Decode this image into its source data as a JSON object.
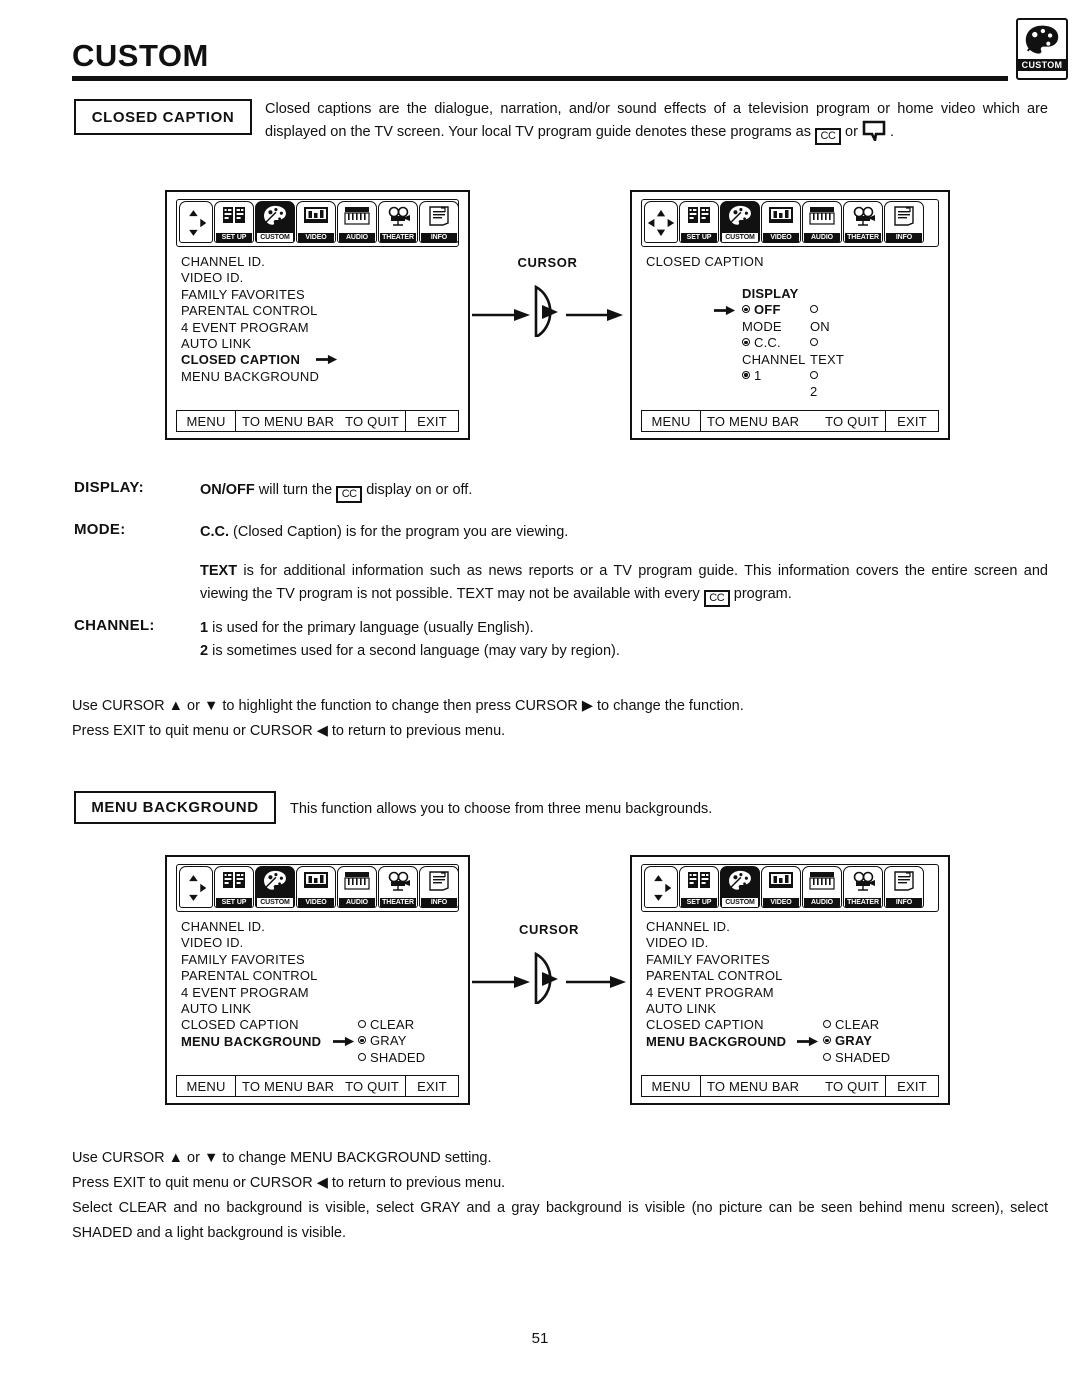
{
  "document": {
    "title": "CUSTOM",
    "page_number": "51",
    "brand_icon_label": "CUSTOM"
  },
  "closed_caption_section": {
    "heading": "CLOSED CAPTION",
    "intro_part1": "Closed captions are the dialogue, narration, and/or sound effects of a television program or home video which are displayed on the TV screen.  Your local TV program guide denotes these programs as",
    "intro_cc_label": "CC",
    "intro_or": "or",
    "intro_end": "."
  },
  "menubar": {
    "items": [
      {
        "label": "SET UP",
        "icon": "setup-icon",
        "selected": false
      },
      {
        "label": "CUSTOM",
        "icon": "palette-icon",
        "selected": true
      },
      {
        "label": "VIDEO",
        "icon": "video-icon",
        "selected": false
      },
      {
        "label": "AUDIO",
        "icon": "audio-icon",
        "selected": false
      },
      {
        "label": "THEATER",
        "icon": "theater-icon",
        "selected": false
      },
      {
        "label": "INFO",
        "icon": "info-icon",
        "selected": false
      }
    ]
  },
  "footer_bar": {
    "menu": "MENU",
    "to_menu_bar": "TO MENU BAR",
    "to_quit": "TO QUIT",
    "exit": "EXIT"
  },
  "custom_menu_items": [
    "CHANNEL ID.",
    "VIDEO ID.",
    "FAMILY FAVORITES",
    "PARENTAL CONTROL",
    "4 EVENT PROGRAM",
    "AUTO LINK",
    "CLOSED CAPTION",
    "MENU BACKGROUND"
  ],
  "screen1": {
    "highlighted_item": "CLOSED CAPTION",
    "cursor_pad": "up-right-down"
  },
  "screen2": {
    "title": "CLOSED CAPTION",
    "cursor_pad": "four-way",
    "groups": [
      {
        "label": "DISPLAY",
        "selected": "OFF",
        "pointer": true,
        "options": [
          {
            "label": "OFF",
            "checked": true
          },
          {
            "label": "ON",
            "checked": false
          }
        ]
      },
      {
        "label": "MODE",
        "selected": "C.C.",
        "pointer": false,
        "options": [
          {
            "label": "C.C.",
            "checked": true
          },
          {
            "label": "TEXT",
            "checked": false
          }
        ]
      },
      {
        "label": "CHANNEL",
        "selected": "1",
        "pointer": false,
        "options": [
          {
            "label": "1",
            "checked": true
          },
          {
            "label": "2",
            "checked": false
          }
        ]
      }
    ]
  },
  "cursor_connector": {
    "label": "CURSOR"
  },
  "definitions": [
    {
      "term": "DISPLAY:",
      "lead": "ON/OFF",
      "text_before_icon": " will turn the ",
      "icon": "CC",
      "text_after_icon": " display on or off."
    },
    {
      "term": "MODE:",
      "lead": "C.C.",
      "text_after": " (Closed Caption) is for the program you are viewing."
    },
    {
      "term": "",
      "lead": "TEXT",
      "text_part1": " is for additional information such as news reports or a TV program guide.  This information covers the entire screen and viewing the TV program is not possible.  TEXT may not be available with every ",
      "icon": "CC",
      "text_part2": " program."
    },
    {
      "term": "CHANNEL:",
      "line1_lead": "1",
      "line1": " is used for the primary language (usually English).",
      "line2_lead": "2",
      "line2": " is sometimes used for a second language (may vary by region)."
    }
  ],
  "instructions_cc": {
    "line1": "Use CURSOR ▲ or ▼ to highlight the function to change then press CURSOR ▶ to change the function.",
    "line2": "Press EXIT to quit menu or CURSOR ◀ to return to previous menu."
  },
  "menu_background_section": {
    "heading": "MENU BACKGROUND",
    "intro": "This function allows you to choose from three menu backgrounds."
  },
  "screen3": {
    "highlighted_item": "MENU BACKGROUND",
    "pointer_on_item": true,
    "cursor_pad": "up-right-down",
    "options": [
      {
        "label": "CLEAR",
        "checked": false
      },
      {
        "label": "GRAY",
        "checked": true
      },
      {
        "label": "SHADED",
        "checked": false
      }
    ],
    "pointer_on_option": null
  },
  "screen4": {
    "highlighted_item": "MENU BACKGROUND",
    "pointer_on_item": false,
    "cursor_pad": "up-right-down",
    "options": [
      {
        "label": "CLEAR",
        "checked": false
      },
      {
        "label": "GRAY",
        "checked": true
      },
      {
        "label": "SHADED",
        "checked": false
      }
    ],
    "pointer_on_option": "GRAY"
  },
  "instructions_bg": {
    "line1": "Use CURSOR ▲ or ▼ to change MENU BACKGROUND setting.",
    "line2": "Press EXIT to quit menu or CURSOR ◀ to return to previous menu.",
    "line3": "Select CLEAR and no background is visible, select GRAY and a gray background is visible (no picture can be seen behind menu screen), select SHADED and a light background is visible."
  },
  "colors": {
    "ink": "#111111",
    "paper": "#ffffff"
  }
}
